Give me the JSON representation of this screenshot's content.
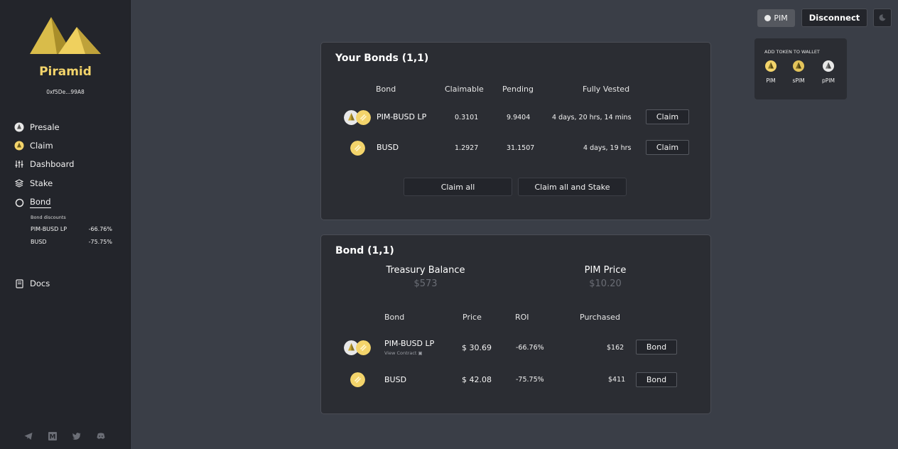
{
  "sidebar": {
    "brand": "Piramid",
    "address": "0xf5De...99A8",
    "nav": [
      {
        "label": "Presale",
        "icon": "presale-icon"
      },
      {
        "label": "Claim",
        "icon": "claim-icon"
      },
      {
        "label": "Dashboard",
        "icon": "dashboard-icon"
      },
      {
        "label": "Stake",
        "icon": "stake-icon"
      },
      {
        "label": "Bond",
        "icon": "bond-icon"
      }
    ],
    "bond_discounts_title": "Bond discounts",
    "discounts": [
      {
        "name": "PIM-BUSD LP",
        "value": "-66.76%"
      },
      {
        "name": "BUSD",
        "value": "-75.75%"
      }
    ],
    "docs": "Docs",
    "socials": [
      "telegram-icon",
      "medium-icon",
      "twitter-icon",
      "discord-icon"
    ]
  },
  "topbar": {
    "pim": "PIM",
    "disconnect": "Disconnect",
    "theme_icon": "moon-icon"
  },
  "wallet": {
    "title": "ADD TOKEN TO WALLET",
    "tokens": [
      "PIM",
      "sPIM",
      "pPIM"
    ]
  },
  "your_bonds": {
    "title": "Your Bonds (1,1)",
    "headers": [
      "Bond",
      "Claimable",
      "Pending",
      "Fully Vested"
    ],
    "rows": [
      {
        "name": "PIM-BUSD LP",
        "claimable": "0.3101",
        "pending": "9.9404",
        "vested": "4 days, 20 hrs, 14 mins",
        "action": "Claim"
      },
      {
        "name": "BUSD",
        "claimable": "1.2927",
        "pending": "31.1507",
        "vested": "4 days, 19 hrs",
        "action": "Claim"
      }
    ],
    "claim_all": "Claim all",
    "claim_all_stake": "Claim all and Stake"
  },
  "bond": {
    "title": "Bond (1,1)",
    "treasury_label": "Treasury Balance",
    "treasury_value": "$573",
    "price_label": "PIM Price",
    "price_value": "$10.20",
    "headers": [
      "Bond",
      "Price",
      "ROI",
      "Purchased"
    ],
    "rows": [
      {
        "name": "PIM-BUSD LP",
        "sub": "View Contract",
        "price": "$ 30.69",
        "roi": "-66.76%",
        "purchased": "$162",
        "action": "Bond"
      },
      {
        "name": "BUSD",
        "price": "$ 42.08",
        "roi": "-75.75%",
        "purchased": "$411",
        "action": "Bond"
      }
    ]
  },
  "colors": {
    "accent": "#f3d46b",
    "background": "#3a3e47",
    "sidebar": "#23252b",
    "card": "#2b2d33"
  }
}
